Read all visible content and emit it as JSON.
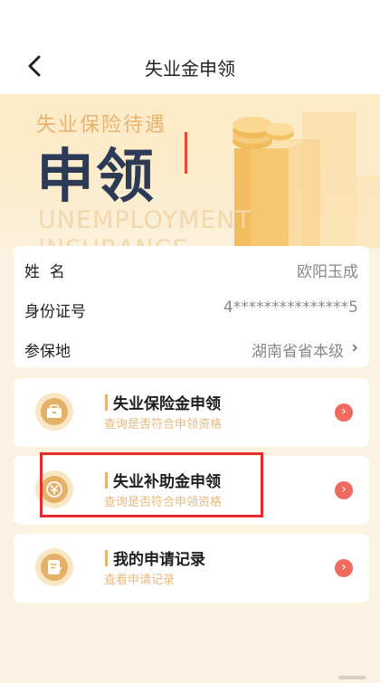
{
  "header": {
    "title": "失业金申领",
    "back_icon": "back-arrow-icon"
  },
  "banner": {
    "subtitle": "失业保险待遇",
    "title": "申领",
    "english_line1": "UNEMPLOYMENT",
    "english_line2": "INSURANCE"
  },
  "profile": {
    "name_label": "姓  名",
    "name_value": "欧阳玉成",
    "id_label": "身份证号",
    "id_value": "4***************5",
    "location_label": "参保地",
    "location_value": "湖南省省本级",
    "location_chevron": "›"
  },
  "menu": [
    {
      "title": "失业保险金申领",
      "subtitle": "查询是否符合申领资格",
      "icon": "briefcase-icon"
    },
    {
      "title": "失业补助金申领",
      "subtitle": "查询是否符合申领资格",
      "icon": "yuan-coin-icon"
    },
    {
      "title": "我的申请记录",
      "subtitle": "查看申请记录",
      "icon": "edit-document-icon"
    }
  ],
  "menu_arrow": "›",
  "colors": {
    "accent": "#e1b46f",
    "arrow": "#f06a5e",
    "highlight": "#e52b2b",
    "banner_title": "#2c3a56"
  }
}
